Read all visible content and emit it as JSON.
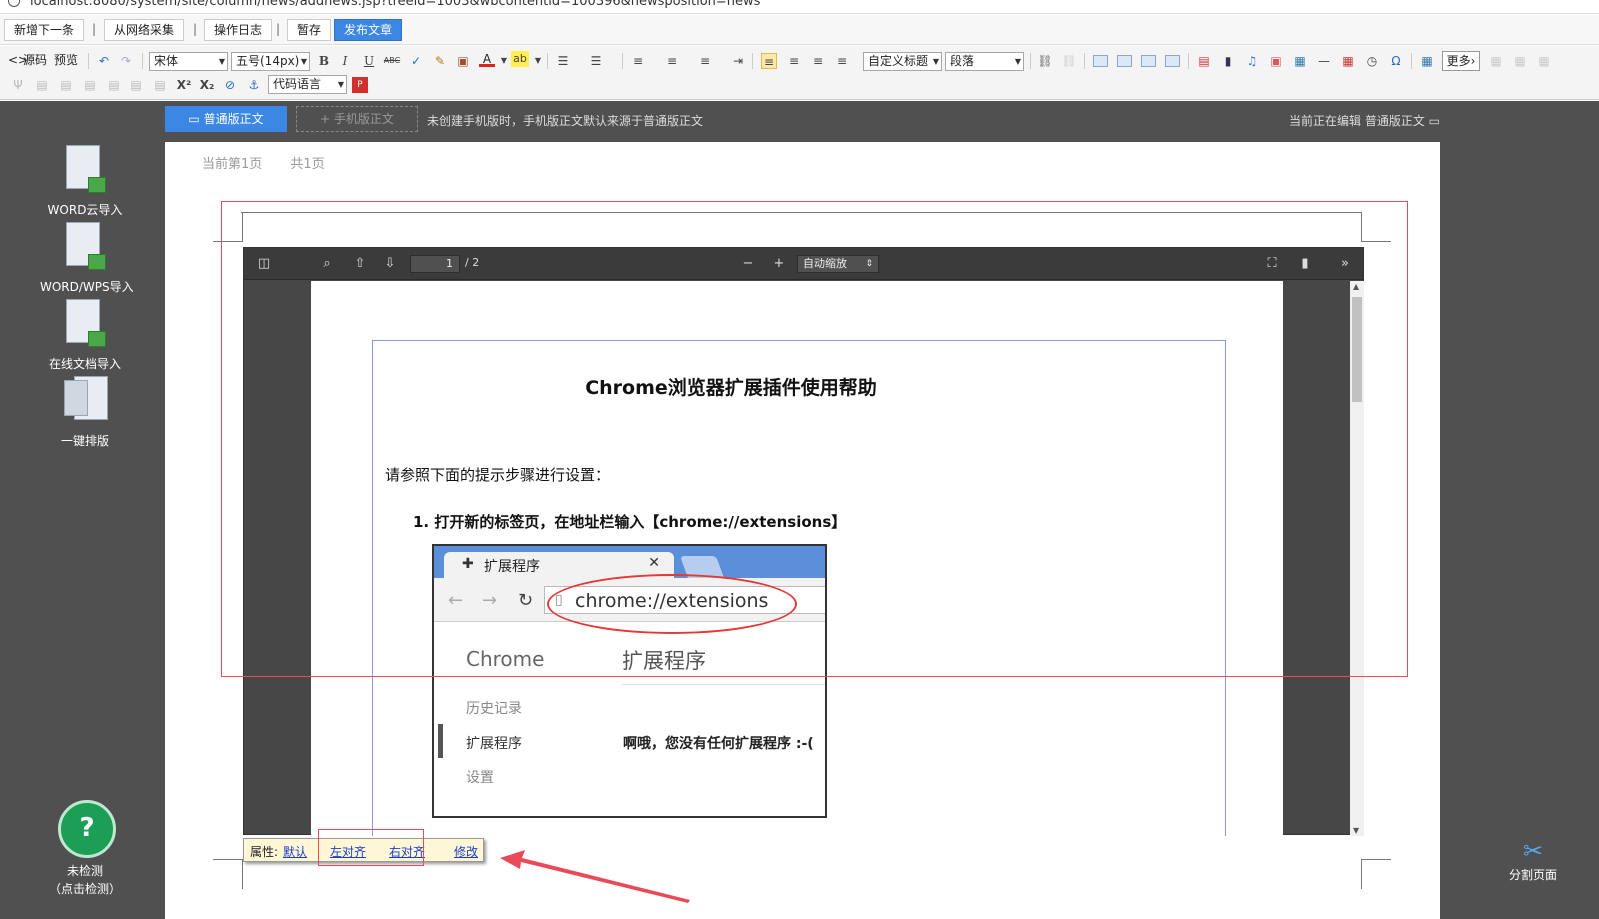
{
  "browser": {
    "url": "localhost:8080/system/site/column/news/addnews.jsp?treeid=1003&wbcontentid=100396&newsposition=news"
  },
  "actions": {
    "add_next": "新增下一条",
    "collect_web": "从网络采集",
    "operation_log": "操作日志",
    "draft": "暂存",
    "publish": "发布文章",
    "sep": "|"
  },
  "toolbar": {
    "source": "源码",
    "preview": "预览",
    "font_family": "宋体",
    "font_size": "五号(14px)",
    "bold": "B",
    "italic": "I",
    "underline": "U",
    "strike": "ABC",
    "font_color": "A",
    "highlight": "ab",
    "custom_heading": "自定义标题",
    "paragraph": "段落",
    "more": "更多",
    "superscript": "X²",
    "subscript": "X₂",
    "code_language": "代码语言"
  },
  "left_panel": {
    "items": [
      {
        "label": "WORD云导入",
        "icon": "cloud-import-icon"
      },
      {
        "label": "WORD/WPS导入",
        "icon": "word-import-icon"
      },
      {
        "label": "在线文档导入",
        "icon": "online-doc-import-icon"
      },
      {
        "label": "一键排版",
        "icon": "one-click-layout-icon"
      }
    ],
    "help_symbol": "?",
    "help_label_1": "未检测",
    "help_label_2": "（点击检测）"
  },
  "version_bar": {
    "normal_tab": "普通版正文",
    "mobile_tab": "手机版正文",
    "note": "未创建手机版时，手机版正文默认来源于普通版正文",
    "editing_status": "当前正在编辑   普通版正文"
  },
  "page": {
    "current_page": "当前第1页",
    "total_pages": "共1页"
  },
  "pdf_viewer": {
    "page_number": "1",
    "page_total": "/ 2",
    "zoom": "自动缩放",
    "zoom_out": "−",
    "zoom_in": "+",
    "document": {
      "title": "Chrome浏览器扩展插件使用帮助",
      "intro": "请参照下面的提示步骤进行设置：",
      "step1": "1. 打开新的标签页，在地址栏输入【chrome://extensions】"
    },
    "chrome_screenshot": {
      "tab_label": "扩展程序",
      "url": "chrome://extensions",
      "brand": "Chrome",
      "heading": "扩展程序",
      "side_history": "历史记录",
      "side_extensions": "扩展程序",
      "side_settings": "设置",
      "empty_message": "啊哦，您没有任何扩展程序 :-("
    }
  },
  "attr_bar": {
    "label": "属性:",
    "default": "默认",
    "align_left": "左对齐",
    "align_right": "右对齐",
    "modify": "修改"
  },
  "split_page": {
    "label": "分割页面"
  },
  "colors": {
    "accent": "#3c86e4",
    "annotation_red": "#e84a5a",
    "workspace_bg": "#505050",
    "help_green": "#1c9e56"
  }
}
